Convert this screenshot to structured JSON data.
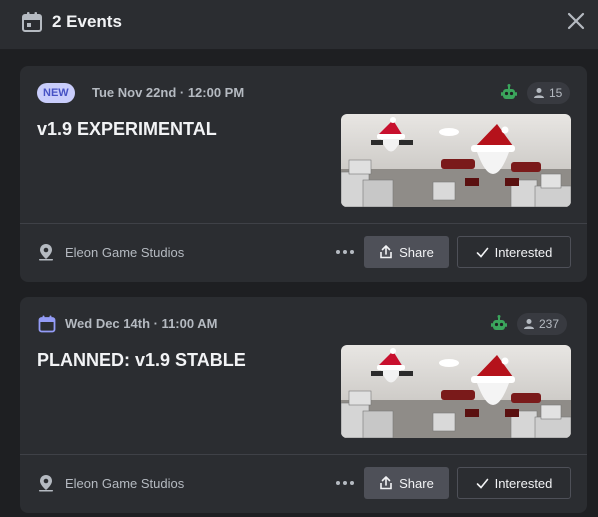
{
  "header": {
    "title": "2 Events"
  },
  "events": [
    {
      "badge": "NEW",
      "date": "Tue Nov 22nd · 12:00 PM",
      "interested_count": "15",
      "title": "v1.9 EXPERIMENTAL",
      "location": "Eleon Game Studios",
      "share_label": "Share",
      "interested_label": "Interested"
    },
    {
      "date": "Wed Dec 14th · 11:00 AM",
      "interested_count": "237",
      "title": "PLANNED: v1.9 STABLE",
      "location": "Eleon Game Studios",
      "share_label": "Share",
      "interested_label": "Interested"
    }
  ],
  "colors": {
    "badge_bg": "#c9cdfb",
    "badge_text": "#4752c4",
    "calendar_accent": "#949cf7",
    "bot_green": "#3ba55c",
    "secondary_button": "#4e5058"
  },
  "icons": [
    "calendar-icon",
    "close-icon",
    "bot-icon",
    "people-icon",
    "location-pin-icon",
    "more-dots-icon",
    "share-icon",
    "checkmark-icon"
  ]
}
